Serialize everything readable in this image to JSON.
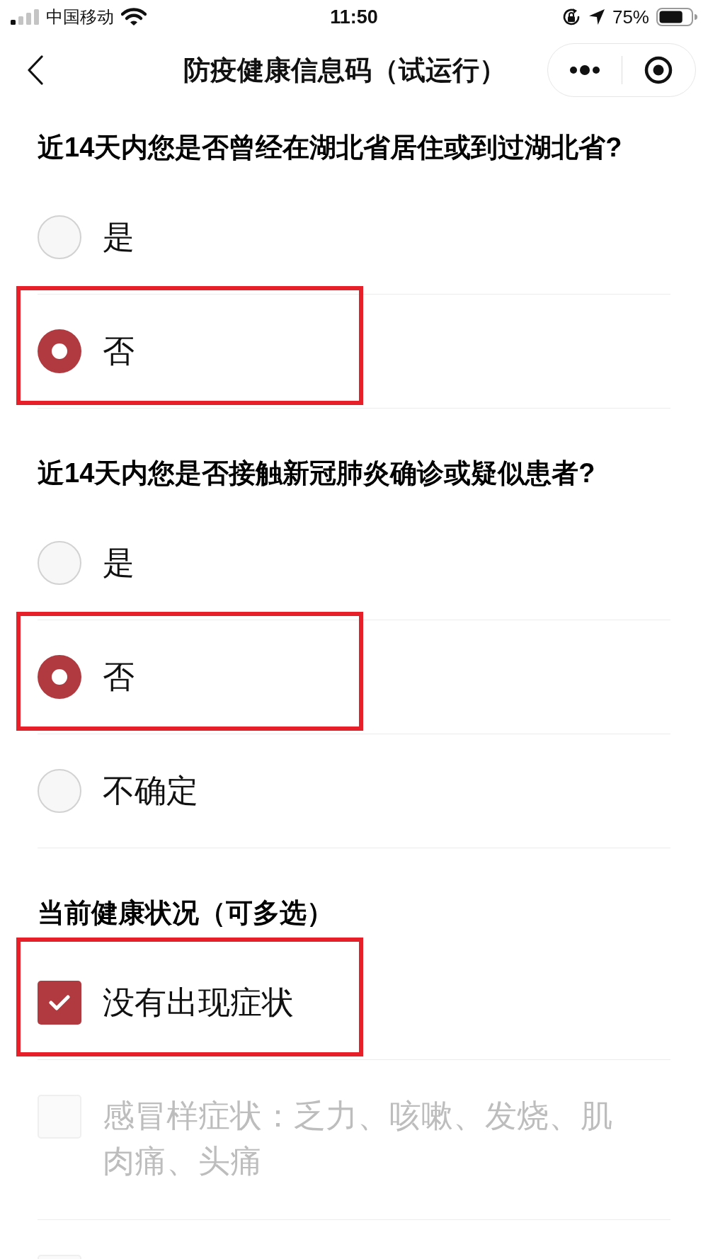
{
  "status_bar": {
    "carrier": "中国移动",
    "time": "11:50",
    "battery": "75%"
  },
  "nav": {
    "title": "防疫健康信息码（试运行）"
  },
  "sections": [
    {
      "question": "近14天内您是否曾经在湖北省居住或到过湖北省?",
      "kind": "radio",
      "options": [
        {
          "label": "是",
          "selected": false,
          "highlighted": false
        },
        {
          "label": "否",
          "selected": true,
          "highlighted": true
        }
      ]
    },
    {
      "question": "近14天内您是否接触新冠肺炎确诊或疑似患者?",
      "kind": "radio",
      "options": [
        {
          "label": "是",
          "selected": false,
          "highlighted": false
        },
        {
          "label": "否",
          "selected": true,
          "highlighted": true
        },
        {
          "label": "不确定",
          "selected": false,
          "highlighted": false
        }
      ]
    },
    {
      "question": "当前健康状况（可多选）",
      "kind": "checkbox",
      "options": [
        {
          "label": "没有出现症状",
          "checked": true,
          "disabled": false,
          "highlighted": true
        },
        {
          "label": "感冒样症状：乏力、咳嗽、发烧、肌肉痛、头痛",
          "checked": false,
          "disabled": true,
          "highlighted": false
        },
        {
          "checked": false,
          "disabled": true,
          "highlighted": false
        }
      ]
    }
  ]
}
